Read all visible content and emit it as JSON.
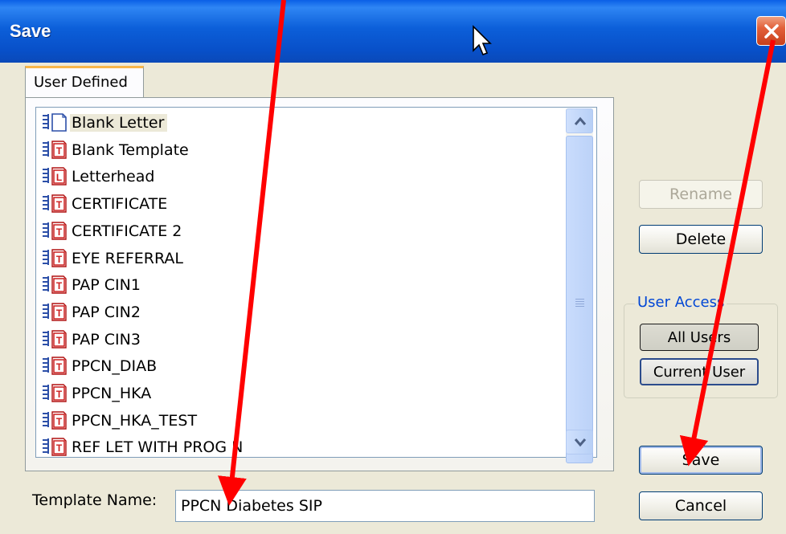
{
  "window": {
    "title": "Save",
    "close_icon": "close-x-icon"
  },
  "tab": {
    "label": "User Defined"
  },
  "templates": {
    "items": [
      {
        "label": "Blank Letter",
        "icon": "blank-letter-doc-icon"
      },
      {
        "label": "Blank Template",
        "icon": "template-t-doc-icon"
      },
      {
        "label": "Letterhead",
        "icon": "letterhead-l-doc-icon"
      },
      {
        "label": "CERTIFICATE",
        "icon": "template-t-doc-icon"
      },
      {
        "label": "CERTIFICATE 2",
        "icon": "template-t-doc-icon"
      },
      {
        "label": "EYE REFERRAL",
        "icon": "template-t-doc-icon"
      },
      {
        "label": "PAP CIN1",
        "icon": "template-t-doc-icon"
      },
      {
        "label": "PAP CIN2",
        "icon": "template-t-doc-icon"
      },
      {
        "label": "PAP CIN3",
        "icon": "template-t-doc-icon"
      },
      {
        "label": "PPCN_DIAB",
        "icon": "template-t-doc-icon"
      },
      {
        "label": "PPCN_HKA",
        "icon": "template-t-doc-icon"
      },
      {
        "label": "PPCN_HKA_TEST",
        "icon": "template-t-doc-icon"
      },
      {
        "label": "REF LET WITH PROG N",
        "icon": "template-t-doc-icon"
      }
    ],
    "selected": "Blank Letter"
  },
  "template_name": {
    "label": "Template Name:",
    "value": "PPCN Diabetes SIP"
  },
  "buttons": {
    "rename": "Rename",
    "delete": "Delete",
    "save": "Save",
    "cancel": "Cancel"
  },
  "user_access": {
    "label": "User Access",
    "all_users": "All Users",
    "current_user": "Current User"
  },
  "colors": {
    "titlebar": "#0a5fe6",
    "annotation_arrow": "#ff0000",
    "group_label": "#0046d5"
  }
}
